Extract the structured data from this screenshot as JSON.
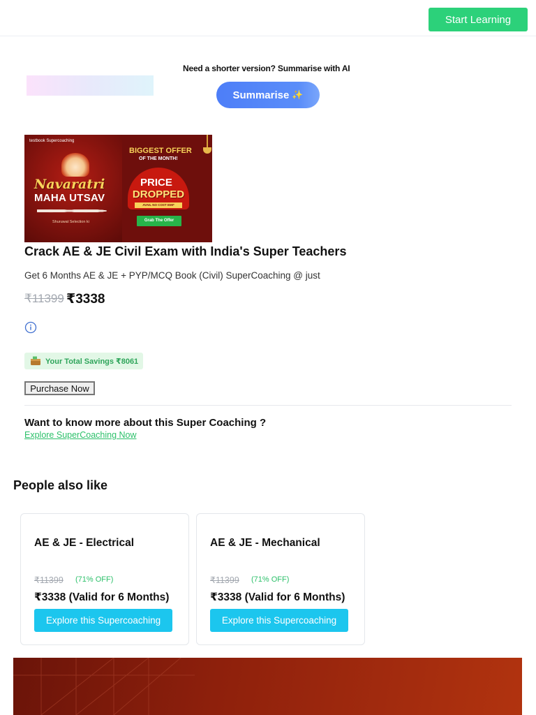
{
  "header": {
    "cta_label": "Start Learning"
  },
  "summarise": {
    "prompt": "Need a shorter version? Summarise with AI",
    "button_label": "Summarise",
    "button_sparkle": "✨"
  },
  "banner": {
    "brand": "testbook Supercoaching",
    "title_line1": "Navaratri",
    "title_line2": "MAHA UTSAV",
    "tagline": "Shuruwat Selection ki",
    "offer_line1": "BIGGEST OFFER",
    "offer_line2": "OF THE MONTH!",
    "price": "PRICE",
    "dropped": "DROPPED",
    "emi": "AVAIL NO COST EMI*",
    "grab": "Grab The Offer"
  },
  "course": {
    "title": "Crack AE & JE Civil Exam with India's Super Teachers",
    "subtitle": "Get 6 Months AE & JE + PYP/MCQ Book (Civil) SuperCoaching @ just",
    "price_old": "₹11399",
    "price_new": "₹3338",
    "savings_text": "Your Total Savings ₹8061",
    "purchase_label": "Purchase Now"
  },
  "more": {
    "question": "Want to know more about this Super Coaching ?",
    "link": "Explore SuperCoaching Now"
  },
  "people_also_like": {
    "heading": "People also like",
    "cards": [
      {
        "title": "AE & JE - Electrical",
        "price_old": "₹11399",
        "discount": "(71% OFF)",
        "price": "₹3338 (Valid for 6 Months)",
        "button": "Explore this Supercoaching"
      },
      {
        "title": "AE & JE - Mechanical",
        "price_old": "₹11399",
        "discount": "(71% OFF)",
        "price": "₹3338 (Valid for 6 Months)",
        "button": "Explore this Supercoaching"
      }
    ]
  },
  "colors": {
    "green_cta": "#2cd17a",
    "summarise_blue": "#4d7ef8",
    "cyan_button": "#1cc6ee",
    "savings_bg": "#e2f7e6",
    "banner_red": "#6e0f0c"
  },
  "icons": {
    "info": "info-circle-icon",
    "savings": "wallet-icon",
    "sparkle": "sparkle-icon"
  }
}
